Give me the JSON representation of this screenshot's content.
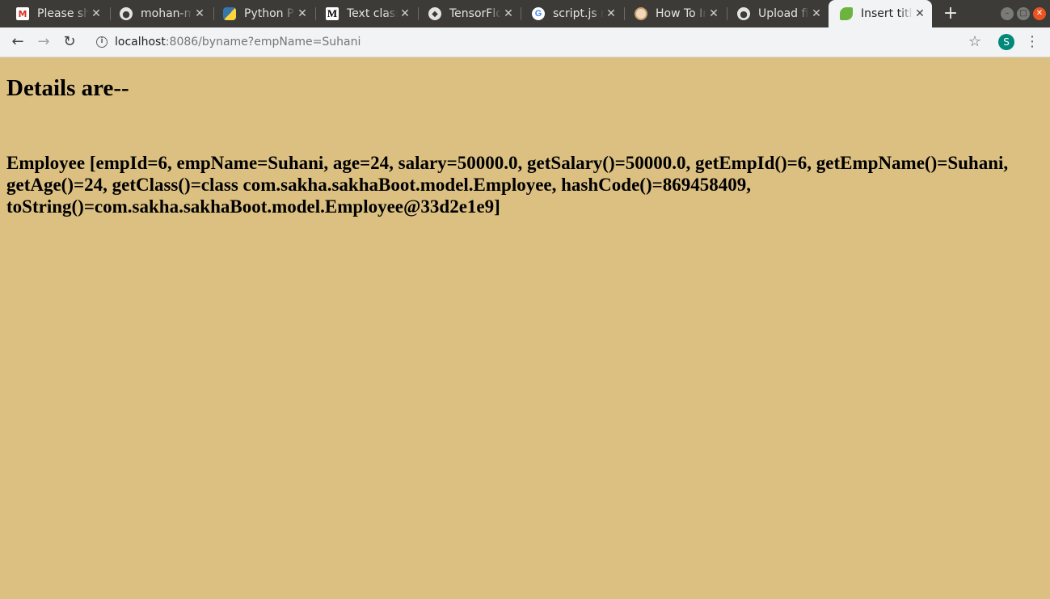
{
  "tabs": [
    {
      "title": "Please sh",
      "icon": "gmail-icon",
      "color": "#d93025"
    },
    {
      "title": "mohan-m",
      "icon": "github-icon",
      "color": "#e4e4e4"
    },
    {
      "title": "Python P",
      "icon": "python-icon",
      "color": "#3776ab"
    },
    {
      "title": "Text class",
      "icon": "medium-icon",
      "color": "#000000"
    },
    {
      "title": "TensorFlo",
      "icon": "tensorflow-icon",
      "color": "#ff6f00"
    },
    {
      "title": "script.js n",
      "icon": "google-icon",
      "color": "#4285f4"
    },
    {
      "title": "How To In",
      "icon": "site-icon",
      "color": "#c8a070"
    },
    {
      "title": "Upload fil",
      "icon": "github-icon",
      "color": "#e4e4e4"
    },
    {
      "title": "Insert titl",
      "icon": "spring-leaf-icon",
      "color": "#6db33f",
      "active": true
    }
  ],
  "toolbar": {
    "url_host": "localhost",
    "url_rest": ":8086/byname?empName=Suhani",
    "avatar_letter": "S"
  },
  "page": {
    "heading": "Details are--",
    "details": "Employee [empId=6, empName=Suhani, age=24, salary=50000.0, getSalary()=50000.0, getEmpId()=6, getEmpName()=Suhani, getAge()=24, getClass()=class com.sakha.sakhaBoot.model.Employee, hashCode()=869458409, toString()=com.sakha.sakhaBoot.model.Employee@33d2e1e9]"
  },
  "colors": {
    "page_background": "#dcc082",
    "tabstrip": "#3c3b37",
    "toolbar": "#f1f3f4",
    "avatar": "#00897b"
  }
}
